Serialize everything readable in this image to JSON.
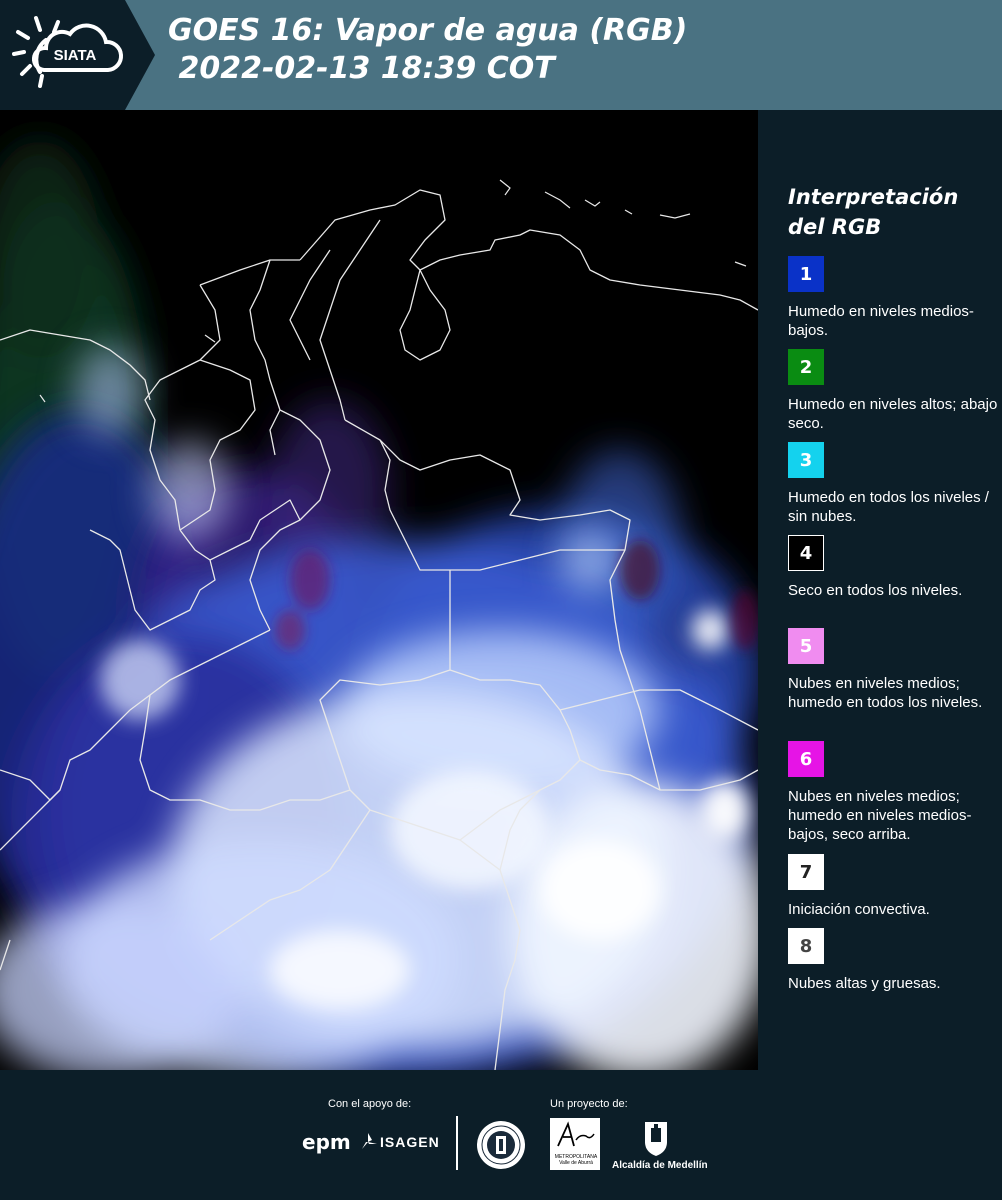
{
  "header": {
    "logo_text": "SIATA",
    "title_line1": "GOES 16: Vapor de agua (RGB)",
    "title_line2": " 2022-02-13 18:39 COT"
  },
  "legend": {
    "title_line1": "Interpretación",
    "title_line2": "del RGB",
    "items": [
      {
        "number": "1",
        "color": "#0a32c8",
        "text_color": "#ffffff",
        "label": "Humedo en niveles medios-bajos."
      },
      {
        "number": "2",
        "color": "#0a8c12",
        "text_color": "#ffffff",
        "label": "Humedo en niveles altos; abajo seco."
      },
      {
        "number": "3",
        "color": "#14d2ee",
        "text_color": "#ffffff",
        "label": "Humedo en todos los niveles / sin nubes."
      },
      {
        "number": "4",
        "color": "#000000",
        "text_color": "#ffffff",
        "label": "Seco en todos los niveles."
      },
      {
        "number": "5",
        "color": "#f08cf0",
        "text_color": "#ffffff",
        "label": "Nubes en niveles medios; humedo en todos los niveles."
      },
      {
        "number": "6",
        "color": "#e614e6",
        "text_color": "#ffffff",
        "label": "Nubes en niveles medios; humedo en niveles medios-bajos, seco arriba."
      },
      {
        "number": "7",
        "color": "#ffffff",
        "text_color": "#222222",
        "label": "Iniciación convectiva."
      },
      {
        "number": "8",
        "color": "#ffffff",
        "text_color": "#444444",
        "label": "Nubes altas y gruesas."
      }
    ]
  },
  "footer": {
    "support_label": "Con el apoyo de:",
    "project_label": "Un proyecto de:",
    "epm": "epm",
    "isagen": "ISAGEN",
    "area_text": "METROPOLITANA Valle de Aburrá",
    "alcaldia": "Alcaldía de Medellín"
  },
  "icons": {
    "logo": "sun-cloud-icon",
    "isagen": "isagen-mark-icon",
    "seal": "antioquia-seal-icon",
    "alcaldia": "medellin-coat-of-arms-icon"
  }
}
